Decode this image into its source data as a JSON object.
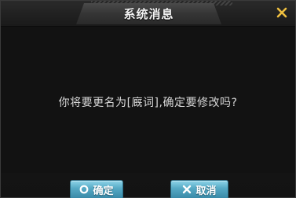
{
  "dialog": {
    "title": "系统消息",
    "message": "你将要更名为[廐词],确定要修改吗?",
    "close_icon": "close-icon"
  },
  "buttons": {
    "ok": {
      "label": "确定",
      "icon": "circle-icon"
    },
    "cancel": {
      "label": "取消",
      "icon": "x-icon"
    }
  },
  "colors": {
    "accent": "#f0c040",
    "button": "#55a9c4",
    "background": "#141414",
    "text": "#d8d8d8"
  }
}
